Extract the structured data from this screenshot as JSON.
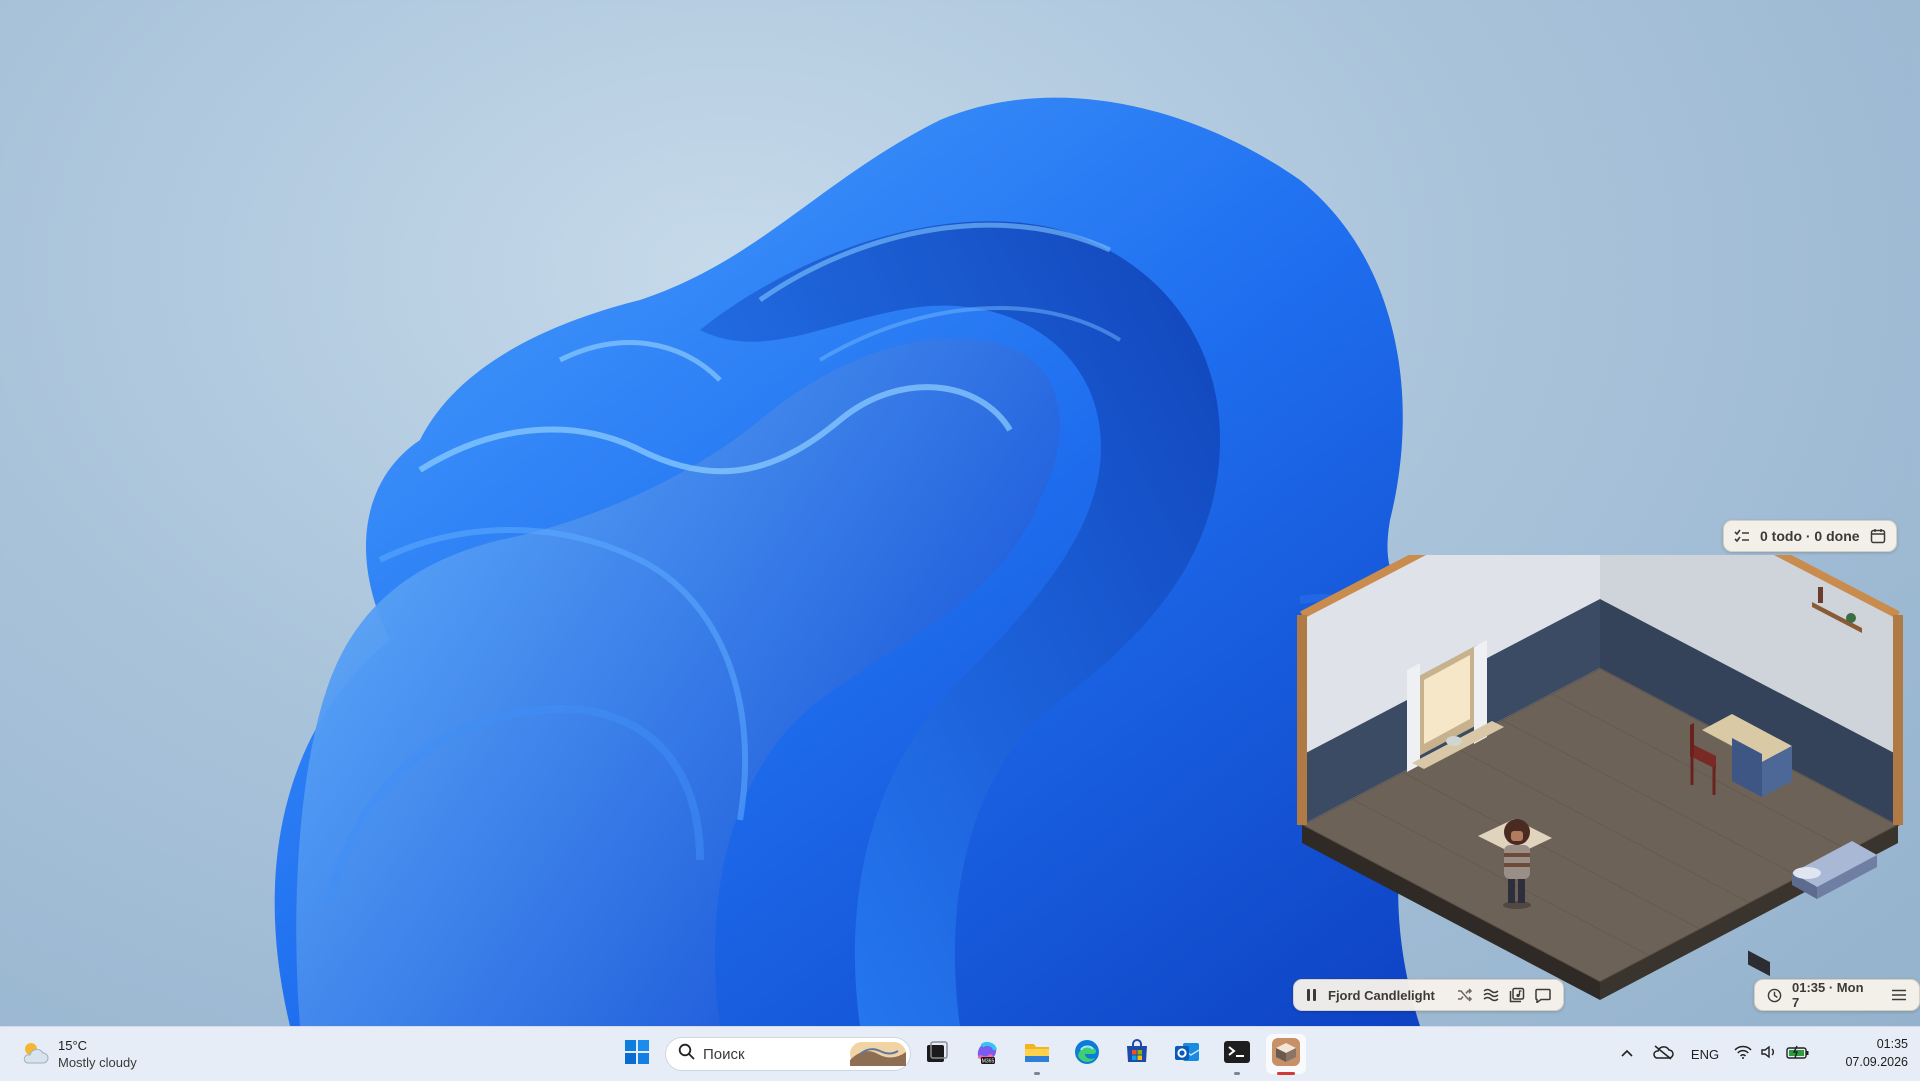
{
  "widgets": {
    "todo": {
      "summary": "0 todo · 0 done"
    },
    "music": {
      "track": "Fjord Candlelight"
    },
    "clock": {
      "label": "01:35 · Mon 7"
    }
  },
  "taskbar": {
    "weather": {
      "temperature": "15°C",
      "condition": "Mostly cloudy"
    },
    "search": {
      "placeholder": "Поиск"
    },
    "pinned": [
      {
        "name": "task-view",
        "running": false
      },
      {
        "name": "microsoft-365-copilot",
        "badge": "M365",
        "running": false
      },
      {
        "name": "file-explorer",
        "running": true
      },
      {
        "name": "microsoft-edge",
        "running": false
      },
      {
        "name": "microsoft-store",
        "running": false
      },
      {
        "name": "outlook",
        "running": false
      },
      {
        "name": "terminal",
        "running": true
      },
      {
        "name": "cozy-room-app",
        "running": true,
        "active": true
      }
    ],
    "tray": {
      "language": "ENG"
    },
    "clock": {
      "time": "01:35",
      "date": "07.09.2026"
    }
  },
  "colors": {
    "taskbar_bg": "#e6edf6",
    "widget_bg": "#f7f1ea",
    "bloom_blue": "#1e6ff0",
    "active_indicator": "#d23a3a"
  }
}
